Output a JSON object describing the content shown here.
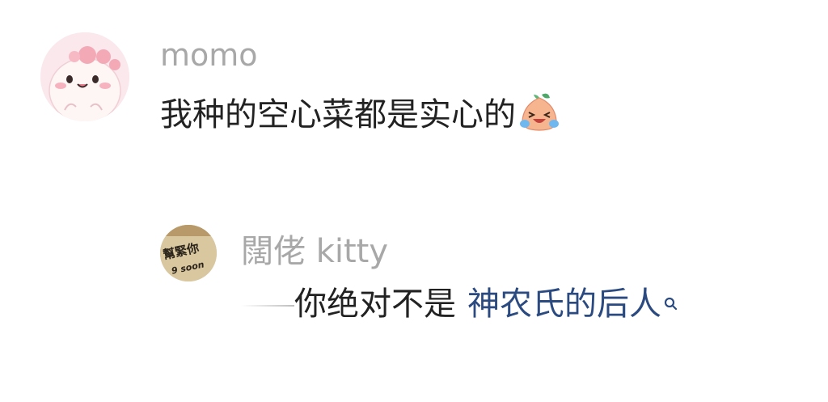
{
  "comments": [
    {
      "username": "momo",
      "text": "我种的空心菜都是实心的",
      "emoji": "crying-laughing-emoji",
      "avatar": "pink-dinosaur-avatar"
    }
  ],
  "reply": {
    "username": "闊佬 kitty",
    "text_plain": "你绝对不是",
    "text_link": "神农氏的后人",
    "link_icon": "search-icon",
    "avatar": "shop-sign-avatar",
    "avatar_sign_chars": "幫緊你",
    "avatar_sign_subtext": "9 soon"
  },
  "colors": {
    "username": "#a8a8a8",
    "text": "#222222",
    "link": "#2a4a80",
    "background": "#ffffff"
  }
}
